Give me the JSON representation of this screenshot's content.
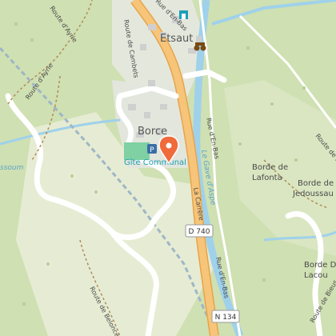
{
  "map": {
    "towns": {
      "etsaut": "Etsaut",
      "borce": "Borce"
    },
    "places": {
      "lafonta": [
        "Borde de",
        "Lafonta"
      ],
      "jedoussau": [
        "Borde de",
        "Jedoussau"
      ],
      "lacou": [
        "Borde De",
        "Lacou"
      ]
    },
    "roads": {
      "ayrie": "Route d'Ayrie",
      "ayrie2": "Route d'Ayrie",
      "cambets": "Route de Cambets",
      "en_bas_top": "Rue d'En-Bas",
      "en_bas": "Rue d'En-Bas",
      "en_bas_bottom": "Rue d'En-Bas",
      "carrere": "La Carrère",
      "belonce": "Route de Belonce",
      "bieus": "Route de Bieus",
      "right_edge": "Route de B"
    },
    "water": {
      "aspe": "Le Gave d'Aspe",
      "left": "ssoum"
    },
    "shields": {
      "d740": "D 740",
      "n134": "N 134"
    },
    "poi": {
      "gite": "Gîte Communal"
    },
    "icons": [
      "marker-icon",
      "parking-icon",
      "binoculars-icon",
      "building-icon"
    ]
  }
}
